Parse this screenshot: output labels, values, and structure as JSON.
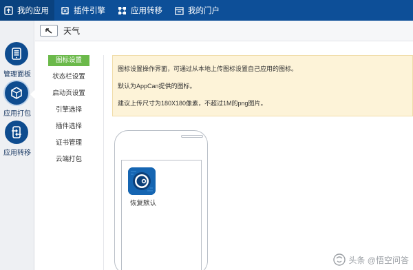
{
  "topnav": {
    "items": [
      {
        "label": "我的应用",
        "icon": "my-apps-icon",
        "active": true
      },
      {
        "label": "插件引擎",
        "icon": "plugin-engine-icon",
        "active": false
      },
      {
        "label": "应用转移",
        "icon": "app-transfer-icon",
        "active": false
      },
      {
        "label": "我的门户",
        "icon": "my-portal-icon",
        "active": false
      }
    ]
  },
  "sidebar": {
    "items": [
      {
        "label": "管理面板",
        "icon": "dashboard-icon",
        "active": false
      },
      {
        "label": "应用打包",
        "icon": "package-icon",
        "active": true
      },
      {
        "label": "应用转移",
        "icon": "transfer-icon",
        "active": false
      }
    ]
  },
  "header": {
    "back_icon": "back-arrow-icon",
    "title": "天气"
  },
  "menu": {
    "items": [
      {
        "label": "图标设置",
        "active": true
      },
      {
        "label": "状态栏设置",
        "active": false
      },
      {
        "label": "启动页设置",
        "active": false
      },
      {
        "label": "引擎选择",
        "active": false
      },
      {
        "label": "插件选择",
        "active": false
      },
      {
        "label": "证书管理",
        "active": false
      },
      {
        "label": "云端打包",
        "active": false
      }
    ]
  },
  "info": {
    "line1": "图标设置操作界面，可通过从本地上传图标设置自己应用的图标。",
    "line2": "默认为AppCan提供的图标。",
    "line3": "建议上传尺寸为180X180像素，不超过1M的png图片。"
  },
  "phone": {
    "app_icon": "appcan-default-icon",
    "restore_label": "恢复默认"
  },
  "watermark": {
    "text": "头条 @悟空问答"
  },
  "colors": {
    "topbar": "#0d4f98",
    "active_menu": "#6bb94a",
    "info_bg": "#fdf3d8"
  }
}
